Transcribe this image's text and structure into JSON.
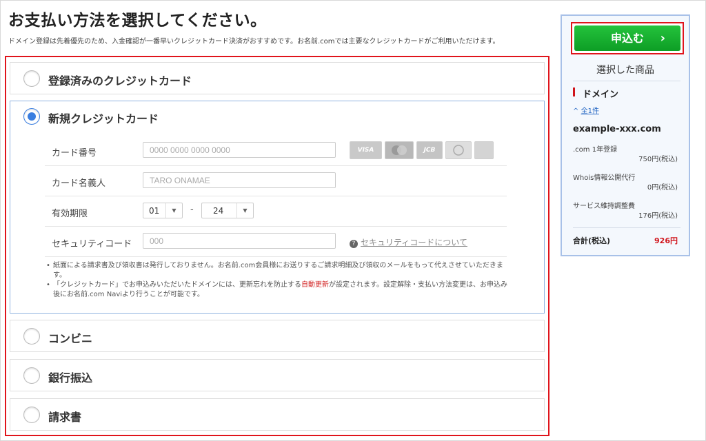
{
  "page": {
    "title": "お支払い方法を選択してください。",
    "subtitle": "ドメイン登録は先着優先のため、入金確認が一番早いクレジットカード決済がおすすめです。お名前.comでは主要なクレジットカードがご利用いただけます。"
  },
  "methods": {
    "registered_card": "登録済みのクレジットカード",
    "new_card": "新規クレジットカード",
    "convenience": "コンビニ",
    "bank": "銀行振込",
    "invoice": "請求書"
  },
  "card_form": {
    "number_label": "カード番号",
    "number_placeholder": "0000 0000 0000 0000",
    "holder_label": "カード名義人",
    "holder_placeholder": "TARO ONAMAE",
    "expiry_label": "有効期限",
    "expiry_month": "01",
    "expiry_sep": "-",
    "expiry_year": "24",
    "cvc_label": "セキュリティコード",
    "cvc_placeholder": "000",
    "cvc_help": "セキュリティコードについて",
    "brands": [
      "VISA",
      "",
      "JCB",
      "",
      ""
    ],
    "notes": {
      "note1": "紙面による請求書及び領収書は発行しておりません。お名前.com会員様にお送りするご請求明細及び領収のメールをもって代えさせていただきます。",
      "note2_a": "「クレジットカード」でお申込みいただいたドメインには、更新忘れを防止する",
      "note2_link": "自動更新",
      "note2_b": "が設定されます。設定解除・支払い方法変更は、お申込み後にお名前.com Naviより行うことが可能です。"
    }
  },
  "summary": {
    "apply_label": "申込む",
    "apply_chevron": "›",
    "title": "選択した商品",
    "category": "ドメイン",
    "toggle_icon": "^",
    "toggle_label": "全1件",
    "domain": "example-xxx.com",
    "items": [
      {
        "name": ".com 1年登録",
        "price": "750円(税込)"
      },
      {
        "name": "Whois情報公開代行",
        "price": "0円(税込)"
      },
      {
        "name": "サービス維持調整費",
        "price": "176円(税込)"
      }
    ],
    "total_label": "合計(税込)",
    "total_value": "926円"
  },
  "colors": {
    "accent_red": "#e0141b",
    "apply_green": "#0d9e25",
    "radio_blue": "#3a7ee0",
    "panel_border": "#a8c1e8"
  }
}
